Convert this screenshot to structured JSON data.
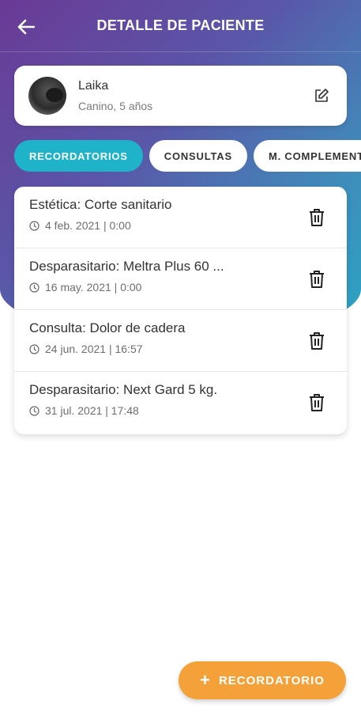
{
  "header": {
    "title": "DETALLE DE PACIENTE",
    "back_icon": "arrow-left-icon"
  },
  "patient": {
    "name": "Laika",
    "description": "Canino, 5 años",
    "edit_icon": "edit-icon"
  },
  "tabs": [
    {
      "label": "RECORDATORIOS",
      "active": true
    },
    {
      "label": "CONSULTAS",
      "active": false
    },
    {
      "label": "M. COMPLEMENTARIOS",
      "active": false
    }
  ],
  "reminders": [
    {
      "title": "Estética: Corte sanitario",
      "datetime": "4 feb. 2021 | 0:00"
    },
    {
      "title": "Desparasitario: Meltra Plus 60 ...",
      "datetime": "16 may. 2021 | 0:00"
    },
    {
      "title": "Consulta: Dolor de cadera",
      "datetime": "24 jun. 2021 | 16:57"
    },
    {
      "title": "Desparasitario: Next Gard 5 kg.",
      "datetime": "31 jul. 2021 | 17:48"
    }
  ],
  "fab": {
    "label": "RECORDATORIO",
    "icon": "plus-icon"
  },
  "colors": {
    "gradient_start": "#6a3a96",
    "gradient_end": "#2aa6c4",
    "active_tab": "#1fb3c9",
    "fab": "#f5a13a"
  }
}
